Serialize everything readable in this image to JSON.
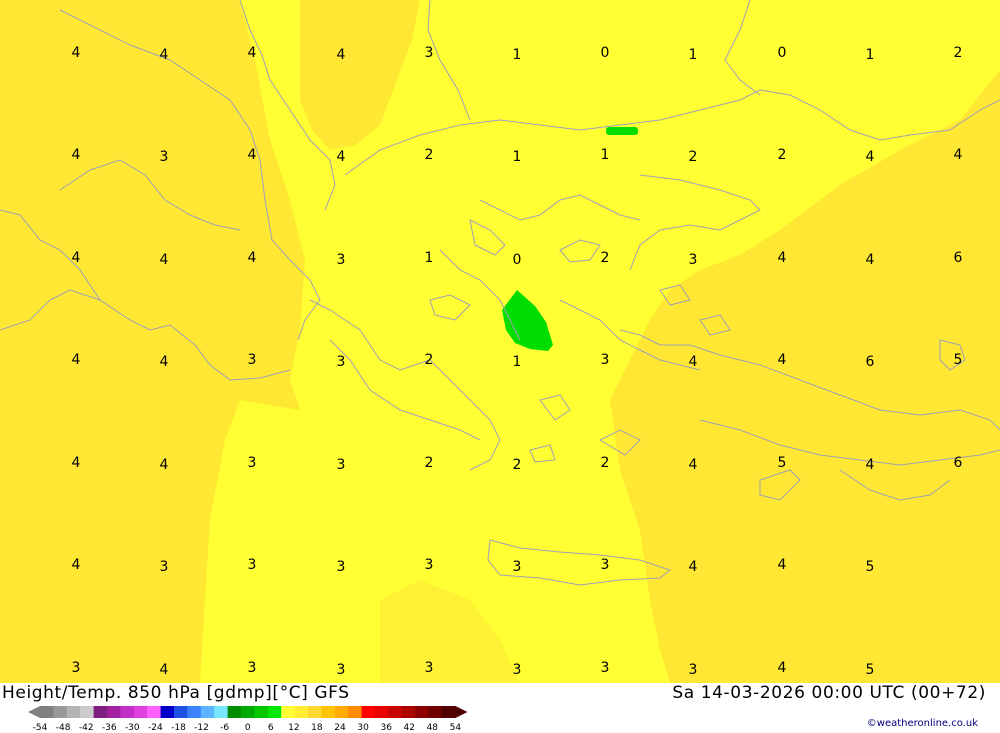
{
  "title": {
    "left": "Height/Temp. 850 hPa [gdmp][°C] GFS",
    "right": "Sa 14-03-2026 00:00 UTC (00+72)"
  },
  "credit": "©weatheronline.co.uk",
  "colors": {
    "field_main": "#ffff33",
    "field_warm": "#ffe733",
    "cold_patch": "#00dd00",
    "coastline": "#a0a0b4"
  },
  "colorbar": {
    "colors": [
      "#808080",
      "#999999",
      "#b3b3b3",
      "#cccccc",
      "#7f1f7f",
      "#a020a0",
      "#c030c8",
      "#e040e0",
      "#ff60ff",
      "#0000c8",
      "#1e4fe6",
      "#3c82ff",
      "#5ab4ff",
      "#78e6ff",
      "#008c00",
      "#00aa00",
      "#00c800",
      "#00e600",
      "#ffff33",
      "#ffec33",
      "#ffd833",
      "#ffc400",
      "#ffaa00",
      "#ff8c00",
      "#ff0000",
      "#e60000",
      "#c80000",
      "#aa0000",
      "#8c0000",
      "#6e0000",
      "#500000"
    ],
    "tick_labels": [
      "-54",
      "-48",
      "-42",
      "-36",
      "-30",
      "-24",
      "-18",
      "-12",
      "-6",
      "0",
      "6",
      "12",
      "18",
      "24",
      "30",
      "36",
      "42",
      "48",
      "54"
    ]
  },
  "grid_values": [
    {
      "row": [
        {
          "v": "4"
        },
        {
          "v": "4"
        },
        {
          "v": "4"
        },
        {
          "v": "4"
        },
        {
          "v": "3"
        },
        {
          "v": "1"
        },
        {
          "v": "0"
        },
        {
          "v": "1"
        },
        {
          "v": "0"
        },
        {
          "v": "1"
        },
        {
          "v": "2"
        }
      ]
    },
    {
      "row": [
        {
          "v": "4"
        },
        {
          "v": "3"
        },
        {
          "v": "4"
        },
        {
          "v": "4"
        },
        {
          "v": "2"
        },
        {
          "v": "1"
        },
        {
          "v": "1"
        },
        {
          "v": "2"
        },
        {
          "v": "2"
        },
        {
          "v": "4"
        },
        {
          "v": "4"
        }
      ]
    },
    {
      "row": [
        {
          "v": "4"
        },
        {
          "v": "4"
        },
        {
          "v": "4"
        },
        {
          "v": "3"
        },
        {
          "v": "1"
        },
        {
          "v": "0"
        },
        {
          "v": "2"
        },
        {
          "v": "3"
        },
        {
          "v": "4"
        },
        {
          "v": "4"
        },
        {
          "v": "6"
        }
      ]
    },
    {
      "row": [
        {
          "v": "4"
        },
        {
          "v": "4"
        },
        {
          "v": "3"
        },
        {
          "v": "3"
        },
        {
          "v": "2"
        },
        {
          "v": "1"
        },
        {
          "v": "3"
        },
        {
          "v": "4"
        },
        {
          "v": "4"
        },
        {
          "v": "6"
        },
        {
          "v": "5"
        }
      ]
    },
    {
      "row": [
        {
          "v": "4"
        },
        {
          "v": "4"
        },
        {
          "v": "3"
        },
        {
          "v": "3"
        },
        {
          "v": "2"
        },
        {
          "v": "2"
        },
        {
          "v": "2"
        },
        {
          "v": "4"
        },
        {
          "v": "5"
        },
        {
          "v": "4"
        },
        {
          "v": "6"
        }
      ]
    },
    {
      "row": [
        {
          "v": "4"
        },
        {
          "v": "3"
        },
        {
          "v": "3"
        },
        {
          "v": "3"
        },
        {
          "v": "3"
        },
        {
          "v": "3"
        },
        {
          "v": "3"
        },
        {
          "v": "4"
        },
        {
          "v": "4"
        },
        {
          "v": "5"
        },
        {
          "v": ""
        }
      ]
    },
    {
      "row": [
        {
          "v": "3"
        },
        {
          "v": "4"
        },
        {
          "v": "3"
        },
        {
          "v": "3"
        },
        {
          "v": "3"
        },
        {
          "v": "3"
        },
        {
          "v": "3"
        },
        {
          "v": "3"
        },
        {
          "v": "4"
        },
        {
          "v": "5"
        },
        {
          "v": ""
        }
      ]
    }
  ]
}
